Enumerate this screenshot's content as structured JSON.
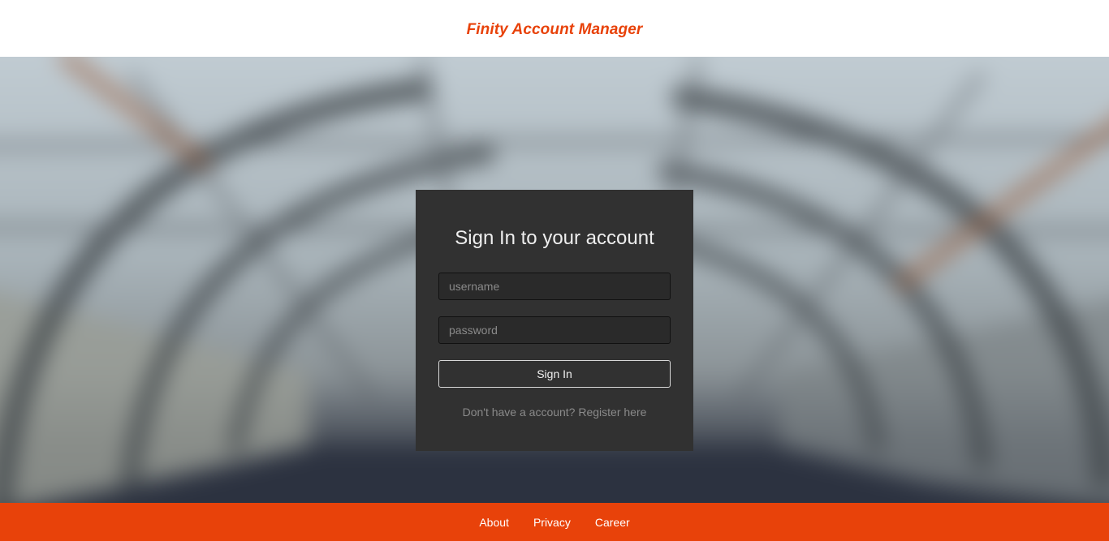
{
  "header": {
    "brand": "Finity Account Manager"
  },
  "login": {
    "title": "Sign In to your account",
    "username_placeholder": "username",
    "password_placeholder": "password",
    "submit_label": "Sign In",
    "register_link": "Don't have a account? Register here"
  },
  "footer": {
    "links": [
      "About",
      "Privacy",
      "Career"
    ]
  },
  "colors": {
    "accent": "#e8420a",
    "card_bg": "#313131",
    "header_bg": "#ffffff"
  }
}
